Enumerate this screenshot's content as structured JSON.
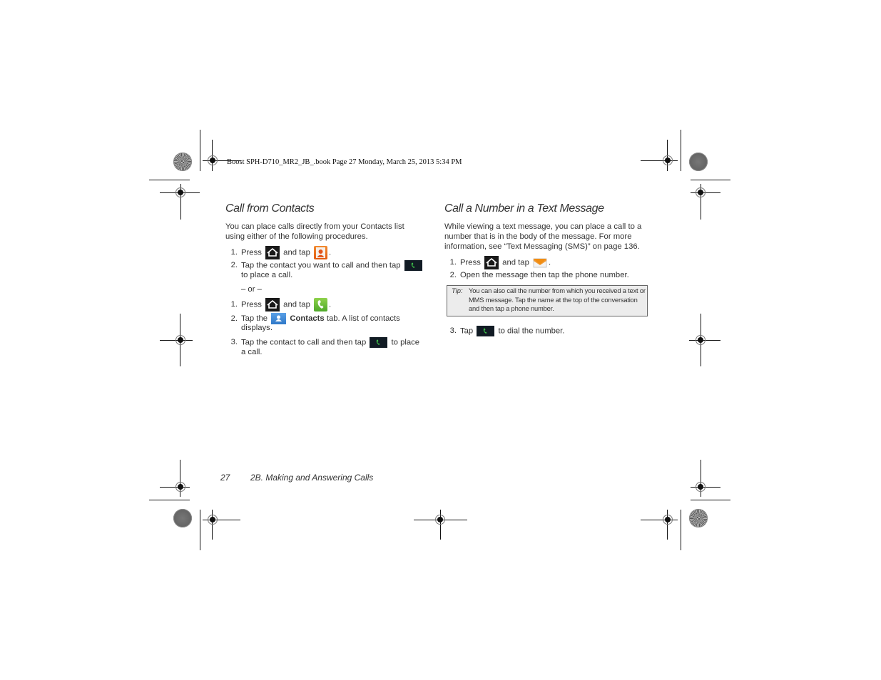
{
  "header": {
    "print_slug": "Boost SPH-D710_MR2_JB_.book  Page 27  Monday, March 25, 2013  5:34 PM"
  },
  "left_column": {
    "title": "Call from Contacts",
    "intro": "You can place calls directly from your Contacts list using either of the following procedures.",
    "procedure_a": [
      {
        "num": "1.",
        "pre": "Press",
        "icon1": "home-key-icon",
        "mid": "and tap",
        "icon2": "contacts-app-icon",
        "post": "."
      },
      {
        "num": "2.",
        "pre": "Tap the contact you want to call and then tap",
        "icon": "call-button-icon",
        "post": "to place a call."
      }
    ],
    "separator": "– or –",
    "procedure_b": [
      {
        "num": "1.",
        "pre": "Press",
        "icon1": "home-key-icon",
        "mid": "and tap",
        "icon2": "phone-app-icon",
        "post": "."
      },
      {
        "num": "2.",
        "pre": "Tap the",
        "icon": "contacts-tab-icon",
        "bold": "Contacts",
        "post": "tab. A list of contacts",
        "post2": "displays."
      },
      {
        "num": "3.",
        "pre": "Tap the contact to call and then tap",
        "icon": "call-button-icon",
        "post": "to place",
        "post2": "a call."
      }
    ]
  },
  "right_column": {
    "title": "Call a Number in a Text Message",
    "intro": "While viewing a text message, you can place a call to a number that is in the body of the message. For more information, see “Text Messaging (SMS)” on page 136.",
    "steps": [
      {
        "num": "1.",
        "pre": "Press",
        "icon1": "home-key-icon",
        "mid": "and tap",
        "icon2": "messaging-app-icon",
        "post": "."
      },
      {
        "num": "2.",
        "text": "Open the message then tap the phone number."
      },
      {
        "num": "3.",
        "pre": "Tap",
        "icon": "call-button-icon",
        "post": "to dial the number."
      }
    ],
    "tip": {
      "label": "Tip:",
      "text": "You can also call the number from which you received a text or MMS message. Tap the name at the top of the conversation and then tap a phone number."
    }
  },
  "footer": {
    "page_number": "27",
    "section_title": "2B. Making and Answering Calls"
  }
}
